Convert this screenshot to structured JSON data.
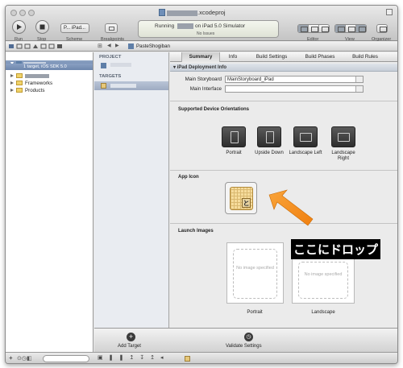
{
  "window": {
    "title_suffix": ".xcodeproj"
  },
  "toolbar": {
    "run_label": "Run",
    "stop_label": "Stop",
    "scheme_label": "Scheme",
    "scheme_value": "P...  iPad...",
    "breakpoints_label": "Breakpoints",
    "status_running": "Running",
    "status_target": "on iPad 5.0 Simulator",
    "status_issues": "No Issues",
    "editor_label": "Editor",
    "view_label": "View",
    "organizer_label": "Organizer"
  },
  "jumpbar": {
    "file": "PasteShogiban"
  },
  "navigator": {
    "project_row": "1 target, iOS SDK 5.0",
    "items": [
      {
        "label": "Frameworks"
      },
      {
        "label": "Products"
      }
    ]
  },
  "targets_panel": {
    "project_heading": "PROJECT",
    "targets_heading": "TARGETS"
  },
  "editor": {
    "tabs": [
      "Summary",
      "Info",
      "Build Settings",
      "Build Phases",
      "Build Rules"
    ],
    "section_title": "iPad Deployment Info",
    "main_storyboard_label": "Main Storyboard",
    "main_storyboard_value": "MainStoryboard_iPad",
    "main_interface_label": "Main Interface",
    "main_interface_value": "",
    "orientations_title": "Supported Device Orientations",
    "orientations": [
      {
        "label": "Portrait"
      },
      {
        "label": "Upside Down"
      },
      {
        "label": "Landscape Left"
      },
      {
        "label": "Landscape Right"
      }
    ],
    "app_icon_title": "App Icon",
    "app_icon_glyph": "と",
    "launch_title": "Launch Images",
    "launch_images": [
      {
        "placeholder": "No image specified",
        "label": "Portrait"
      },
      {
        "placeholder": "No image specified",
        "label": "Landscape"
      }
    ]
  },
  "editor_bottom": {
    "add_target_label": "Add Target",
    "validate_label": "Validate Settings"
  },
  "annotation": {
    "callout_text": "ここにドロップ",
    "arrow_color": "#f7941d"
  }
}
